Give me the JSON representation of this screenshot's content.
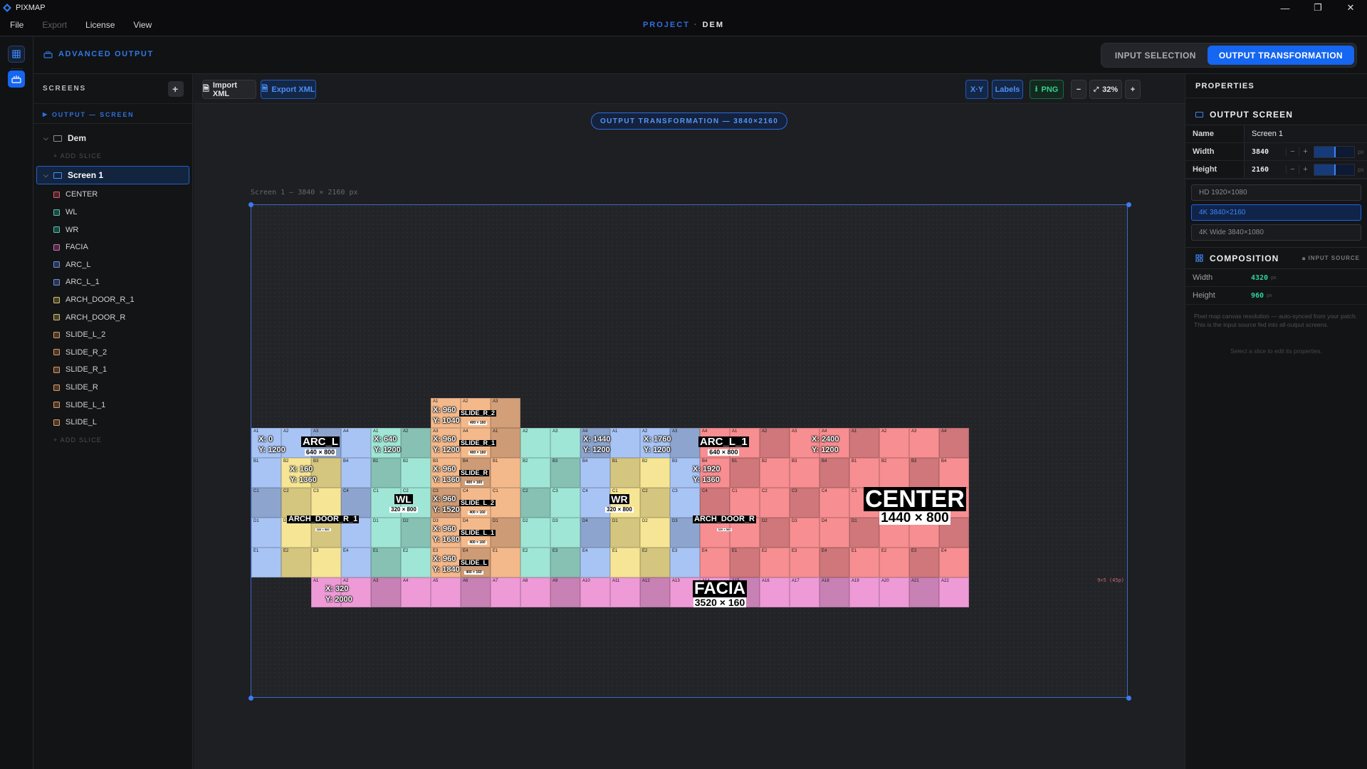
{
  "app": {
    "name": "PIXMAP",
    "project_key": "PROJECT",
    "project_sep": "·",
    "project_name": "DEM"
  },
  "menu": [
    "File",
    "Export",
    "License",
    "View"
  ],
  "toolbar": {
    "title": "ADVANCED OUTPUT",
    "tabs": [
      "INPUT SELECTION",
      "OUTPUT TRANSFORMATION"
    ],
    "active_tab": "OUTPUT TRANSFORMATION"
  },
  "sidebar": {
    "header": "SCREENS",
    "add": "+",
    "subheader": "OUTPUT — SCREEN",
    "groups": [
      {
        "name": "Dem",
        "add_slice": "+ ADD SLICE"
      },
      {
        "name": "Screen 1",
        "selected": true,
        "slices": [
          {
            "name": "CENTER",
            "color": "#e05b63"
          },
          {
            "name": "WL",
            "color": "#4fc6ae"
          },
          {
            "name": "WR",
            "color": "#4fc6ae"
          },
          {
            "name": "FACIA",
            "color": "#d86cb4"
          },
          {
            "name": "ARC_L",
            "color": "#6e8ee0"
          },
          {
            "name": "ARC_L_1",
            "color": "#6e8ee0"
          },
          {
            "name": "ARCH_DOOR_R_1",
            "color": "#d6c06a"
          },
          {
            "name": "ARCH_DOOR_R",
            "color": "#d6c06a"
          },
          {
            "name": "SLIDE_L_2",
            "color": "#e09a62"
          },
          {
            "name": "SLIDE_R_2",
            "color": "#e09a62"
          },
          {
            "name": "SLIDE_R_1",
            "color": "#e09a62"
          },
          {
            "name": "SLIDE_R",
            "color": "#e09a62"
          },
          {
            "name": "SLIDE_L_1",
            "color": "#e09a62"
          },
          {
            "name": "SLIDE_L",
            "color": "#e09a62"
          }
        ],
        "add_slice": "+ ADD SLICE"
      }
    ]
  },
  "canvas_toolbar": {
    "import": "Import XML",
    "export": "Export XML",
    "xy": "X·Y",
    "labels": "Labels",
    "png": "PNG",
    "zoom_out": "−",
    "zoom": "32%",
    "zoom_in": "+"
  },
  "canvas": {
    "badge": "OUTPUT TRANSFORMATION — 3840×2160",
    "screen_label": "Screen 1 — 3840 × 2160 px",
    "grid_note": "9×5 (45p)",
    "slices": [
      {
        "name": "ARC_L",
        "dims": "640 × 800",
        "x": "X: 0",
        "y": "Y: 1200"
      },
      {
        "name": "WL",
        "dims": "320 × 800",
        "x": "X: 640",
        "y": "Y: 1200"
      },
      {
        "name": "SLIDE_R_2",
        "dims": "400 × 160",
        "x": "X: 960",
        "y": "Y: 1040"
      },
      {
        "name": "SLIDE_R_1",
        "dims": "400 × 160",
        "x": "X: 960",
        "y": "Y: 1200"
      },
      {
        "name": "SLIDE_R",
        "dims": "400 × 160",
        "x": "X: 960",
        "y": "Y: 1360"
      },
      {
        "name": "SLIDE_L_2",
        "dims": "400 × 160",
        "x": "X: 960",
        "y": "Y: 1520"
      },
      {
        "name": "SLIDE_L_1",
        "dims": "400 × 160",
        "x": "X: 960",
        "y": "Y: 1680"
      },
      {
        "name": "SLIDE_L",
        "dims": "400 × 160",
        "x": "X: 960",
        "y": "Y: 1840"
      },
      {
        "name": "WR",
        "dims": "320 × 800",
        "x": "X: 1440",
        "y": "Y: 1200"
      },
      {
        "name": "ARC_L_1",
        "dims": "640 × 800",
        "x": "X: 1760",
        "y": "Y: 1200"
      },
      {
        "name": "ARCH_DOOR_R_1",
        "dims": "320 × 560",
        "x": "X: 160",
        "y": "Y: 1360"
      },
      {
        "name": "ARCH_DOOR_R",
        "dims": "320 × 560",
        "x": "X: 1920",
        "y": "Y: 1360"
      },
      {
        "name": "CENTER",
        "dims": "1440 × 800",
        "x": "X: 2400",
        "y": "Y: 1200"
      },
      {
        "name": "FACIA",
        "dims": "3520 × 160",
        "x": "X: 320",
        "y": "Y: 2000"
      }
    ]
  },
  "properties": {
    "header": "PROPERTIES",
    "output_screen": {
      "title": "OUTPUT SCREEN",
      "name_label": "Name",
      "name": "Screen 1",
      "width_label": "Width",
      "width": "3840",
      "height_label": "Height",
      "height": "2160",
      "unit": "px",
      "minus": "−",
      "plus": "+"
    },
    "presets": [
      "HD 1920×1080",
      "4K 3840×2160",
      "4K Wide 3840×1080"
    ],
    "active_preset": "4K 3840×2160",
    "composition": {
      "title": "COMPOSITION",
      "badge": "INPUT SOURCE",
      "width_label": "Width",
      "width": "4320",
      "height_label": "Height",
      "height": "960",
      "unit": "px",
      "note": "Pixel map canvas resolution — auto-synced from your patch. This is the input source fed into all output screens.",
      "hint": "Select a slice to edit its properties."
    }
  },
  "colors": {
    "accent": "#1566f0",
    "center": "#f78e91",
    "wl": "#9fe6d6",
    "arc": "#a8c4f5",
    "arch": "#f6e594",
    "slide": "#f4b98b",
    "facia": "#ee9ad6"
  }
}
